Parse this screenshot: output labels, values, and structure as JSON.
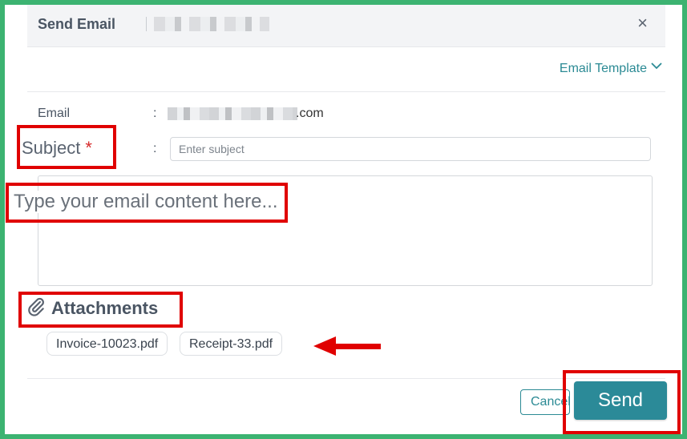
{
  "dialog": {
    "title": "Send Email",
    "close_symbol": "×"
  },
  "toolbar": {
    "email_template_label": "Email Template",
    "chevron": "⌄"
  },
  "form": {
    "email_label": "Email",
    "email_value_visible_suffix": ".com",
    "colon": ":",
    "subject_label": "Subject",
    "subject_required_mark": "*",
    "subject_placeholder": "Enter subject",
    "content_placeholder": "Type your email content here..."
  },
  "attachments": {
    "title": "Attachments",
    "files": [
      "Invoice-10023.pdf",
      "Receipt-33.pdf"
    ]
  },
  "actions": {
    "cancel_label": "Cancel",
    "send_label": "Send"
  },
  "colors": {
    "accent": "#2b8a94",
    "highlight": "#e00000",
    "frame": "#3cb371"
  },
  "icons": [
    "close-icon",
    "chevron-down-icon",
    "paperclip-icon",
    "arrow-left-icon"
  ]
}
